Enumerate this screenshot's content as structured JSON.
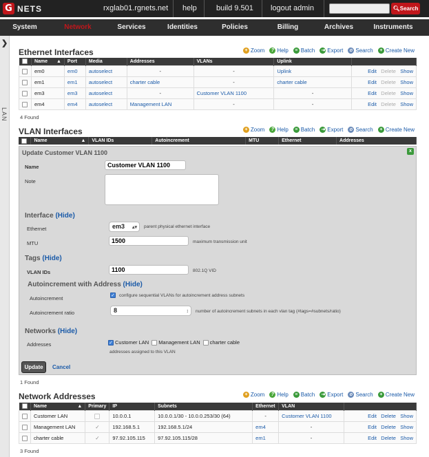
{
  "topbar": {
    "logo": "NETS",
    "host": "rxglab01.rgnets.net",
    "help": "help",
    "build": "build 9.501",
    "logout": "logout admin",
    "search_btn": "Search"
  },
  "nav": [
    "System",
    "Network",
    "Services",
    "Identities",
    "Policies",
    "Billing",
    "Archives",
    "Instruments"
  ],
  "side_label": "LAN",
  "toolbar": {
    "zoom": "Zoom",
    "help": "Help",
    "batch": "Batch",
    "export": "Export",
    "search": "Search",
    "create": "Create New"
  },
  "eth": {
    "title": "Ethernet Interfaces",
    "headers": [
      "Name",
      "Port",
      "Media",
      "Addresses",
      "VLANs",
      "Uplink"
    ],
    "rows": [
      {
        "name": "em0",
        "port": "em0",
        "media": "autoselect",
        "addr": "-",
        "vlans": "-",
        "uplink": "Uplink"
      },
      {
        "name": "em1",
        "port": "em1",
        "media": "autoselect",
        "addr": "charter cable",
        "vlans": "-",
        "uplink": "charter cable"
      },
      {
        "name": "em3",
        "port": "em3",
        "media": "autoselect",
        "addr": "-",
        "vlans": "Customer VLAN 1100",
        "uplink": "-"
      },
      {
        "name": "em4",
        "port": "em4",
        "media": "autoselect",
        "addr": "Management LAN",
        "vlans": "-",
        "uplink": "-"
      }
    ],
    "found": "4 Found"
  },
  "actions": {
    "edit": "Edit",
    "delete": "Delete",
    "show": "Show"
  },
  "vlan": {
    "title": "VLAN Interfaces",
    "headers": [
      "Name",
      "VLAN IDs",
      "Autoincrement",
      "MTU",
      "Ethernet",
      "Addresses"
    ],
    "found": "1 Found"
  },
  "form": {
    "title": "Update Customer VLAN 1100",
    "name_label": "Name",
    "name_value": "Customer VLAN 1100",
    "note_label": "Note",
    "interface_group": "Interface",
    "hide": "(Hide)",
    "ethernet_label": "Ethernet",
    "ethernet_value": "em3",
    "ethernet_hint": "parent physical ethernet interface",
    "mtu_label": "MTU",
    "mtu_value": "1500",
    "mtu_hint": "maximum transmission unit",
    "tags_group": "Tags",
    "vlanids_label": "VLAN IDs",
    "vlanids_value": "1100",
    "vlanids_hint": "802.1Q VID",
    "autoinc_group": "Autoincrement with Address",
    "autoinc_label": "Autoincrement",
    "autoinc_hint": "configure sequential VLANs for autoincrement address subnets",
    "ratio_label": "Autoincrement ratio",
    "ratio_value": "8",
    "ratio_hint": "number of autoincrement subnets in each vlan tag (#tags=#subnets/ratio)",
    "networks_group": "Networks",
    "addresses_label": "Addresses",
    "addr_opts": [
      "Customer LAN",
      "Management LAN",
      "charter cable"
    ],
    "addr_hint": "addresses assigned to this VLAN",
    "update": "Update",
    "cancel": "Cancel"
  },
  "net": {
    "title": "Network Addresses",
    "headers": [
      "Name",
      "Primary",
      "IP",
      "Subnets",
      "Ethernet",
      "VLAN"
    ],
    "rows": [
      {
        "name": "Customer LAN",
        "ip": "10.0.0.1",
        "subnets": "10.0.0.1/30 - 10.0.0.253/30 (64)",
        "eth": "-",
        "vlan": "Customer VLAN 1100"
      },
      {
        "name": "Management LAN",
        "ip": "192.168.5.1",
        "subnets": "192.168.5.1/24",
        "eth": "em4",
        "vlan": "-"
      },
      {
        "name": "charter cable",
        "ip": "97.92.105.115",
        "subnets": "97.92.105.115/28",
        "eth": "em1",
        "vlan": "-"
      }
    ],
    "found": "3 Found"
  }
}
